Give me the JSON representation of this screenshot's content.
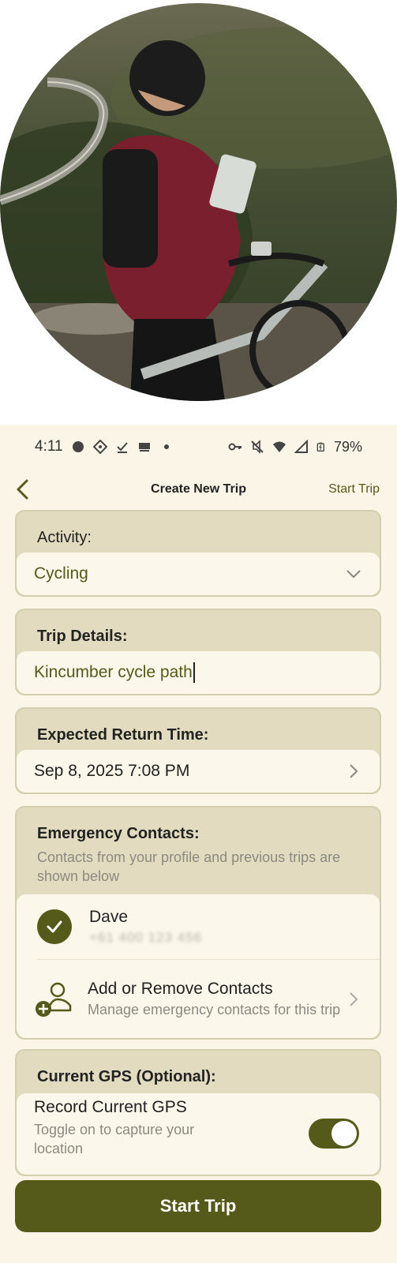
{
  "status_bar": {
    "time": "4:11",
    "battery": "79%"
  },
  "nav": {
    "title": "Create New Trip",
    "action": "Start Trip"
  },
  "activity": {
    "label": "Activity:",
    "value": "Cycling"
  },
  "trip_details": {
    "label": "Trip Details:",
    "value": "Kincumber cycle path"
  },
  "return_time": {
    "label": "Expected Return Time:",
    "value": "Sep 8, 2025 7:08 PM"
  },
  "emergency": {
    "label": "Emergency Contacts:",
    "description": "Contacts from your profile and previous trips are shown below",
    "contacts": [
      {
        "name": "Dave",
        "phone": "+61 400 123 456",
        "selected": true
      }
    ],
    "manage_title": "Add or Remove Contacts",
    "manage_subtitle": "Manage emergency contacts for this trip"
  },
  "gps": {
    "label": "Current GPS (Optional):",
    "row_title": "Record Current GPS",
    "row_subtitle": "Toggle on to capture your location",
    "enabled": true
  },
  "primary_button": "Start Trip",
  "colors": {
    "accent": "#555a1a",
    "background": "#faf5e6",
    "card": "#e2dbbf",
    "field": "#fbf7ea"
  },
  "icons": [
    "back-chevron-icon",
    "dropdown-chevron-icon",
    "forward-chevron-icon",
    "check-icon",
    "add-person-icon",
    "wifi-icon",
    "signal-icon",
    "battery-icon",
    "key-icon",
    "mute-icon"
  ]
}
